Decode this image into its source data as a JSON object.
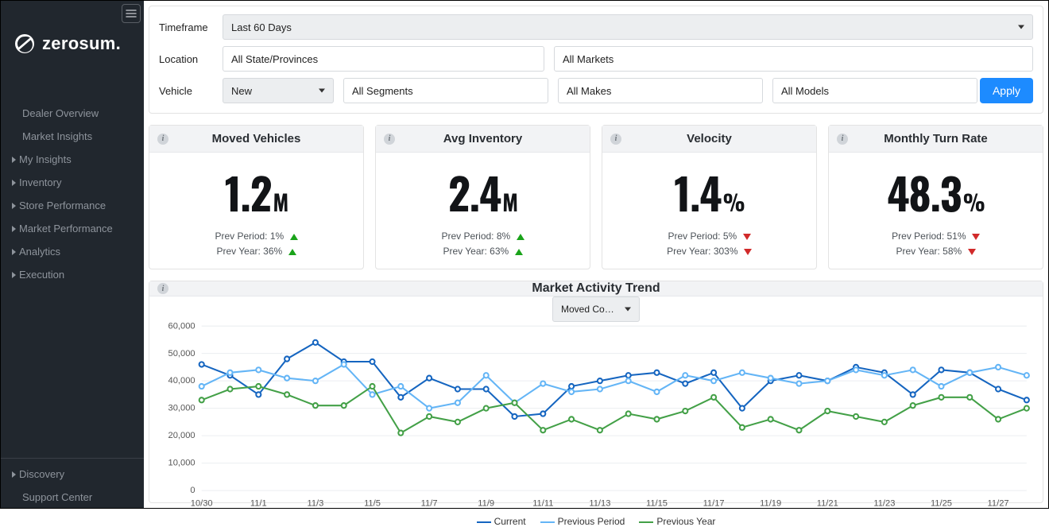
{
  "brand": {
    "name": "zerosum."
  },
  "sidebar": {
    "items_top": [
      {
        "label": "Dealer Overview",
        "expandable": false
      },
      {
        "label": "Market Insights",
        "expandable": false
      },
      {
        "label": "My Insights",
        "expandable": true
      },
      {
        "label": "Inventory",
        "expandable": true
      },
      {
        "label": "Store Performance",
        "expandable": true
      },
      {
        "label": "Market Performance",
        "expandable": true
      },
      {
        "label": "Analytics",
        "expandable": true
      },
      {
        "label": "Execution",
        "expandable": true
      }
    ],
    "items_bottom": [
      {
        "label": "Discovery",
        "expandable": true
      },
      {
        "label": "Support Center",
        "expandable": false
      }
    ]
  },
  "filters": {
    "timeframe_label": "Timeframe",
    "timeframe": "Last 60 Days",
    "location_label": "Location",
    "location_state": "All State/Provinces",
    "location_market": "All Markets",
    "vehicle_label": "Vehicle",
    "vehicle_condition": "New",
    "vehicle_segment": "All Segments",
    "vehicle_make": "All Makes",
    "vehicle_model": "All Models",
    "apply": "Apply"
  },
  "cards": [
    {
      "title": "Moved Vehicles",
      "value": "1.2",
      "unit": "M",
      "prev_period": "Prev Period: 1%",
      "prev_period_dir": "up",
      "prev_year": "Prev Year: 36%",
      "prev_year_dir": "up"
    },
    {
      "title": "Avg Inventory",
      "value": "2.4",
      "unit": "M",
      "prev_period": "Prev Period: 8%",
      "prev_period_dir": "up",
      "prev_year": "Prev Year: 63%",
      "prev_year_dir": "up"
    },
    {
      "title": "Velocity",
      "value": "1.4",
      "unit": "%",
      "prev_period": "Prev Period: 5%",
      "prev_period_dir": "dn",
      "prev_year": "Prev Year: 303%",
      "prev_year_dir": "dn"
    },
    {
      "title": "Monthly Turn Rate",
      "value": "48.3",
      "unit": "%",
      "prev_period": "Prev Period: 51%",
      "prev_period_dir": "dn",
      "prev_year": "Prev Year: 58%",
      "prev_year_dir": "dn"
    }
  ],
  "chart": {
    "title": "Market Activity Trend",
    "selector": "Moved Cou…",
    "legend": [
      {
        "name": "Current",
        "color": "#1565c0"
      },
      {
        "name": "Previous Period",
        "color": "#64b5f6"
      },
      {
        "name": "Previous Year",
        "color": "#43a047"
      }
    ]
  },
  "chart_data": {
    "type": "line",
    "title": "Market Activity Trend",
    "xlabel": "",
    "ylabel": "",
    "ylim": [
      0,
      60000
    ],
    "yticks": [
      0,
      10000,
      20000,
      30000,
      40000,
      50000,
      60000
    ],
    "ytick_labels": [
      "0",
      "10,000",
      "20,000",
      "30,000",
      "40,000",
      "50,000",
      "60,000"
    ],
    "x": [
      "10/30",
      "10/31",
      "11/1",
      "11/2",
      "11/3",
      "11/4",
      "11/5",
      "11/6",
      "11/7",
      "11/8",
      "11/9",
      "11/10",
      "11/11",
      "11/12",
      "11/13",
      "11/14",
      "11/15",
      "11/16",
      "11/17",
      "11/18",
      "11/19",
      "11/20",
      "11/21",
      "11/22",
      "11/23",
      "11/24",
      "11/25",
      "11/26",
      "11/27",
      "11/28"
    ],
    "x_tick_every": 2,
    "series": [
      {
        "name": "Current",
        "color": "#1565c0",
        "values": [
          46000,
          42000,
          35000,
          48000,
          54000,
          47000,
          47000,
          34000,
          41000,
          37000,
          37000,
          27000,
          28000,
          38000,
          40000,
          42000,
          43000,
          39000,
          43000,
          30000,
          40000,
          42000,
          40000,
          45000,
          43000,
          35000,
          44000,
          43000,
          37000,
          33000
        ]
      },
      {
        "name": "Previous Period",
        "color": "#64b5f6",
        "values": [
          38000,
          43000,
          44000,
          41000,
          40000,
          46000,
          35000,
          38000,
          30000,
          32000,
          42000,
          32000,
          39000,
          36000,
          37000,
          40000,
          36000,
          42000,
          40000,
          43000,
          41000,
          39000,
          40000,
          44000,
          42000,
          44000,
          38000,
          43000,
          45000,
          42000
        ]
      },
      {
        "name": "Previous Year",
        "color": "#43a047",
        "values": [
          33000,
          37000,
          38000,
          35000,
          31000,
          31000,
          38000,
          21000,
          27000,
          25000,
          30000,
          32000,
          22000,
          26000,
          22000,
          28000,
          26000,
          29000,
          34000,
          23000,
          26000,
          22000,
          29000,
          27000,
          25000,
          31000,
          34000,
          34000,
          26000,
          30000
        ]
      }
    ]
  }
}
